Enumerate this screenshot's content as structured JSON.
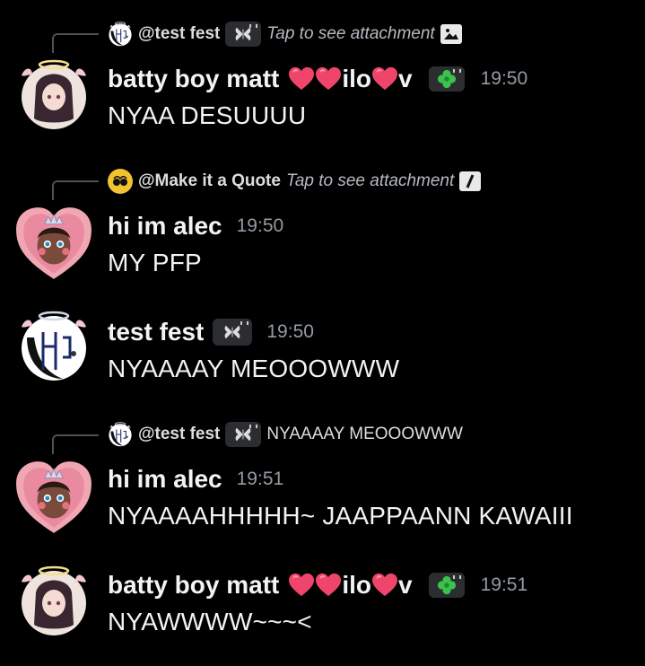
{
  "messages": [
    {
      "reply": {
        "name": "@test fest",
        "text": "Tap to see attachment",
        "icon": "image-attachment-icon"
      },
      "author": "batty boy matt",
      "name_suffix_1": "ilo",
      "name_suffix_2": "v",
      "time": "19:50",
      "content": "NYAA DESUUUU"
    },
    {
      "reply": {
        "name": "@Make it a Quote",
        "text": "Tap to see attachment",
        "icon": "slash-command-icon"
      },
      "author": "hi im alec",
      "time": "19:50",
      "content": "MY PFP"
    },
    {
      "author": "test fest",
      "time": "19:50",
      "content": "NYAAAAY MEOOOWWW"
    },
    {
      "reply": {
        "name": "@test fest",
        "text": "NYAAAAY MEOOOWWW"
      },
      "author": "hi im alec",
      "time": "19:51",
      "content": "NYAAAAHHHHH~ JAAPPAANN KAWAIII"
    },
    {
      "author": "batty boy matt",
      "name_suffix_1": "ilo",
      "name_suffix_2": "v",
      "time": "19:51",
      "content": "NYAWWWW~~~<"
    }
  ],
  "colors": {
    "background": "#000000",
    "timestamp": "#949ba4",
    "heart": "#f0456b",
    "tag": "#2b2d31"
  }
}
